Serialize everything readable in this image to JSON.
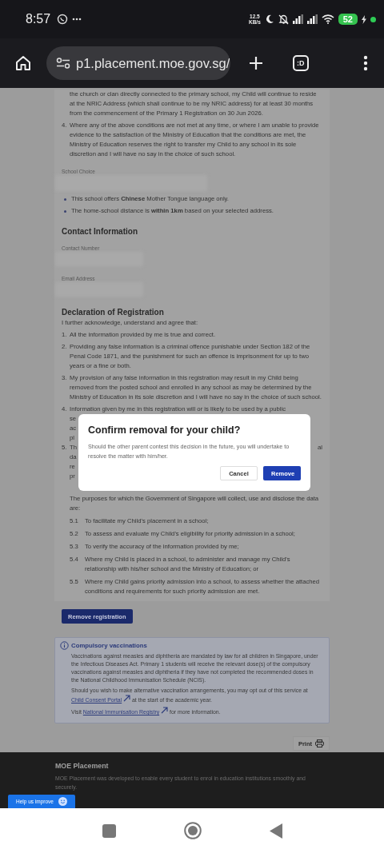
{
  "status_bar": {
    "time": "8:57",
    "speed_value": "12.5",
    "speed_unit": "KB/s",
    "battery": "52"
  },
  "browser": {
    "url": "p1.placement.moe.gov.sg/",
    "tab_switcher": ":D"
  },
  "top_text": "the church or clan directly connected to the primary school, my Child will continue to reside at the NRIC Address (which shall continue to be my NRIC address) for at least 30 months from the commencement of the Primary 1 Registration on 30 Jun 2026.",
  "conditions": [
    {
      "number": "4.",
      "text": "Where any of the above conditions are not met at any time, or where I am unable to provide evidence to the satisfaction of the Ministry of Education that the conditions are met, the Ministry of Education reserves the right to transfer my Child to any school in its sole discretion and I will have no say in the choice of such school."
    }
  ],
  "school_choice": {
    "label": "School Choice",
    "notes": [
      "This school offers **Chinese** Mother Tongue language only.",
      "The home-school distance is **within 1km** based on your selected address."
    ]
  },
  "contact": {
    "heading": "Contact Information",
    "fields": [
      {
        "label": "Contact Number"
      },
      {
        "label": "Email Address"
      }
    ]
  },
  "declaration": {
    "heading": "Declaration of Registration",
    "intro": "I further acknowledge, understand and agree that:",
    "items": [
      {
        "number": "1.",
        "text": "All the information provided by me is true and correct."
      },
      {
        "number": "2.",
        "text": "Providing any false information is a criminal offence punishable under Section 182 of the Penal Code 1871, and the punishment for such an offence is imprisonment for up to two years or a fine or both."
      },
      {
        "number": "3.",
        "text": "My provision of any false information in this registration may result in my Child being removed from the posted school and enrolled in any school as may be determined by the Ministry of Education in its sole discretion and I will have no say in the choice of such school."
      },
      {
        "number": "4.",
        "text": "Information given by me in this registration will or is likely to be used by a public"
      }
    ],
    "covered_lines": [
      {
        "left": "se"
      },
      {
        "left": "ac"
      },
      {
        "left": "pl"
      },
      {
        "number": "5.",
        "left": "Th",
        "right": "al"
      },
      {
        "left": "da"
      },
      {
        "left": "re"
      },
      {
        "left": "pr"
      }
    ],
    "purposes": "The purposes for which the Government of Singapore will collect, use and disclose the data are:",
    "purpose_items": [
      {
        "number": "5.1",
        "text": "To facilitate my Child's placement in a school;"
      },
      {
        "number": "5.2",
        "text": "To assess and evaluate my Child's eligibility for priority admission in a school;"
      },
      {
        "number": "5.3",
        "text": "To verify the accuracy of the information provided by me;"
      },
      {
        "number": "5.4",
        "text": "Where my Child is placed in a school, to administer and manage my Child's relationship with his/her school and the Ministry of Education; or"
      },
      {
        "number": "5.5",
        "text": "Where my Child gains priority admission into a school, to assess whether the attached conditions and requirements for such priority admission are met."
      }
    ]
  },
  "remove_button": "Remove registration",
  "vaccination_notice": {
    "title": "Compulsory vaccinations",
    "body": "Vaccinations against measles and diphtheria are mandated by law for all children in Singapore, under the Infectious Diseases Act. Primary 1 students will receive the relevant dose(s) of the compulsory vaccinations against measles and diphtheria if they have not completed the recommended doses in the National Childhood Immunisation Schedule (NCIS).",
    "opt_out_before": "Should you wish to make alternative vaccination arrangements, you may opt out of this service at",
    "opt_out_link": "Child Consent Portal",
    "opt_out_after": "at the start of the academic year.",
    "visit_before": "Visit",
    "visit_link": "National Immunisation Registry",
    "visit_after": "for more information."
  },
  "print_button": "Print",
  "dialog": {
    "title": "Confirm removal for your child?",
    "message": "Should the other parent contest this decision in the future, you will undertake to resolve the matter with him/her.",
    "buttons": [
      {
        "label": "Cancel",
        "kind": "secondary"
      },
      {
        "label": "Remove",
        "kind": "primary"
      }
    ]
  },
  "footer": {
    "title": "MOE Placement",
    "description": "MOE Placement was developed to enable every student to enrol in education institutions smoothly and securely."
  },
  "feedback_button": "Help us improve"
}
